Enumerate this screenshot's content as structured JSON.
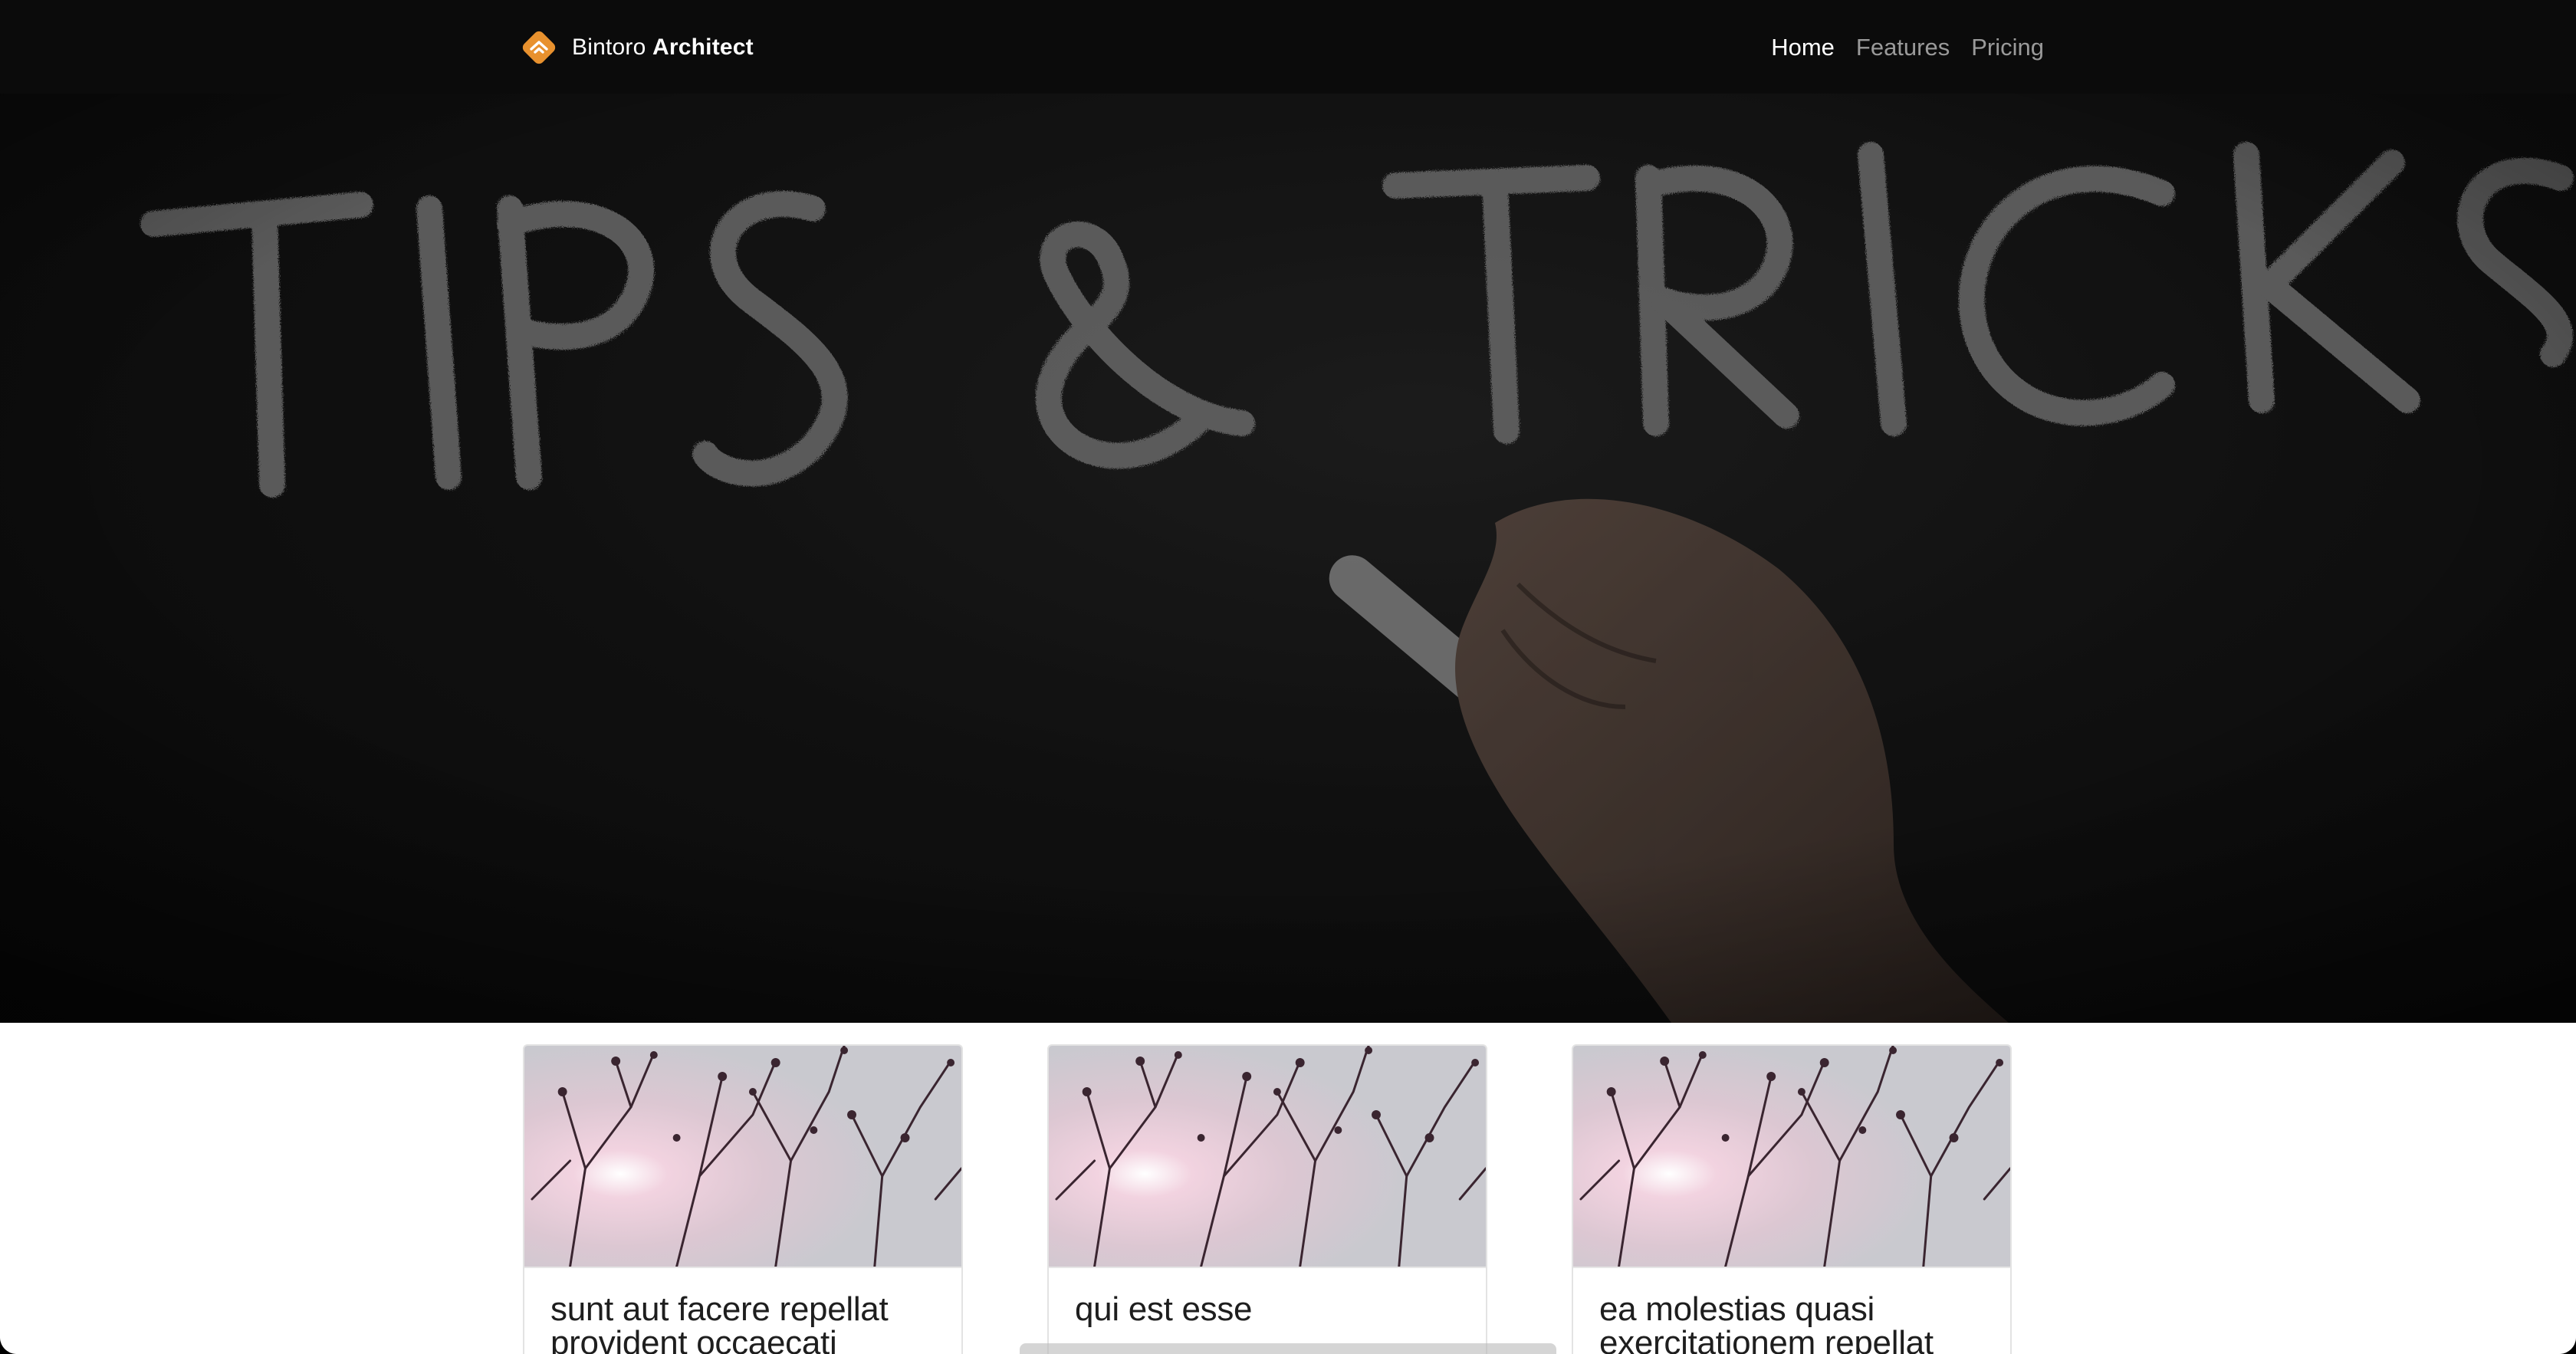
{
  "brand": {
    "name_light": "Bintoro",
    "name_bold": "Architect",
    "logo_icon": "diamond-house-icon",
    "logo_color": "#e8912e"
  },
  "nav": {
    "items": [
      {
        "label": "Home",
        "active": true
      },
      {
        "label": "Features",
        "active": false
      },
      {
        "label": "Pricing",
        "active": false
      }
    ]
  },
  "hero": {
    "image_icon": "chalkboard-tips-and-tricks-image",
    "chalk_text": "TIPS & TRICKS"
  },
  "cards": [
    {
      "title": "sunt aut facere repellat provident occaecati",
      "image_icon": "tree-silhouette-image"
    },
    {
      "title": "qui est esse",
      "image_icon": "tree-silhouette-image"
    },
    {
      "title": "ea molestias quasi exercitationem repellat",
      "image_icon": "tree-silhouette-image"
    }
  ]
}
